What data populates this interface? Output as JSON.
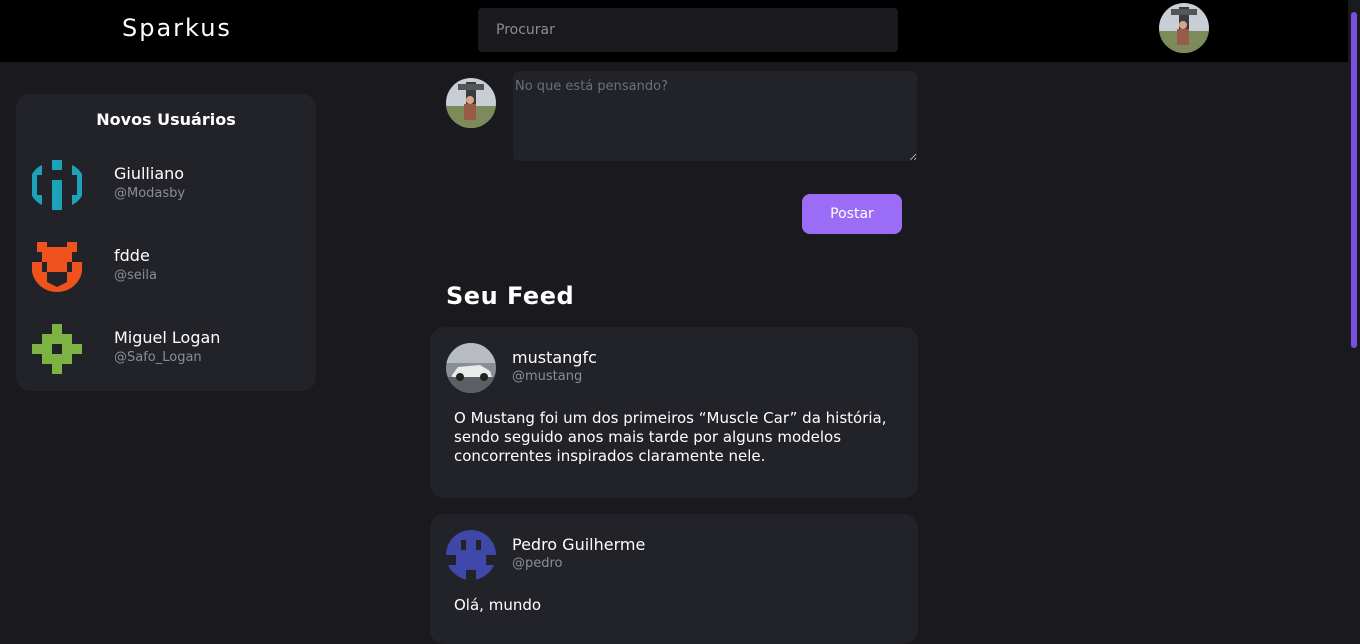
{
  "header": {
    "brand": "Sparkus",
    "search_placeholder": "Procurar",
    "profile_avatar": "profile-photo"
  },
  "sidebar": {
    "title": "Novos Usuários",
    "users": [
      {
        "name": "Giulliano",
        "handle": "@Modasby",
        "avatar": "identicon",
        "color": "#1ca3b8"
      },
      {
        "name": "fdde",
        "handle": "@seila",
        "avatar": "identicon",
        "color": "#f0521e"
      },
      {
        "name": "Miguel Logan",
        "handle": "@Safo_Logan",
        "avatar": "identicon",
        "color": "#7cb342"
      }
    ]
  },
  "composer": {
    "placeholder": "No que está pensando?",
    "post_label": "Postar"
  },
  "feed": {
    "title": "Seu Feed",
    "posts": [
      {
        "name": "mustangfc",
        "handle": "@mustang",
        "avatar": "car-photo",
        "text": "O Mustang foi um dos primeiros “Muscle Car” da história, sendo seguido anos mais tarde por alguns modelos concorrentes inspirados claramente nele."
      },
      {
        "name": "Pedro Guilherme",
        "handle": "@pedro",
        "avatar": "identicon",
        "color": "#3f48a8",
        "text": "Olá, mundo"
      }
    ]
  },
  "colors": {
    "accent": "#9b6cf5",
    "background": "#1a1a1e",
    "card": "#222229",
    "topbar": "#000000"
  }
}
